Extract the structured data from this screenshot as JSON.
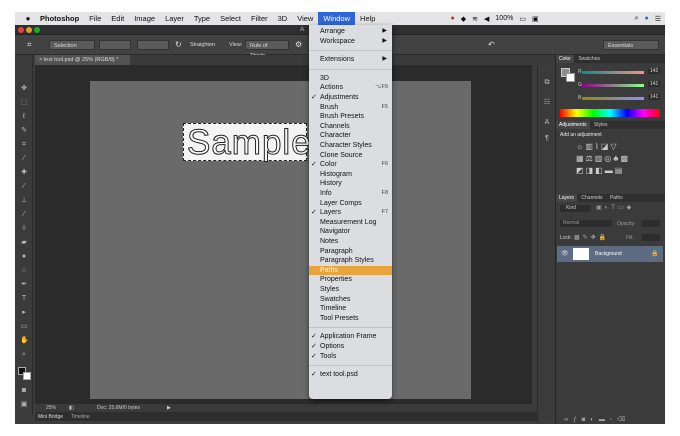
{
  "menubar": {
    "apple": "",
    "items": [
      "Photoshop",
      "File",
      "Edit",
      "Image",
      "Layer",
      "Type",
      "Select",
      "Filter",
      "3D",
      "View",
      "Window",
      "Help"
    ],
    "battery": "100%"
  },
  "options": {
    "preset": "Selection",
    "straighten": "Straighten",
    "view_label": "View:",
    "view_value": "Rule of Thirds",
    "workspace": "Essentials"
  },
  "title_fragment": "A",
  "document_tab": "text tool.psd @ 25% (RGB/8) *",
  "canvas_text": "Sample",
  "status": {
    "zoom": "25%",
    "doc": "Doc: 25.6M/0 bytes"
  },
  "bottom_tabs": [
    "Mini Bridge",
    "Timeline"
  ],
  "color_panel": {
    "tabs": [
      "Color",
      "Swatches"
    ],
    "sliders": [
      {
        "label": "R",
        "value": "142",
        "color": "#e24a4a"
      },
      {
        "label": "G",
        "value": "141",
        "color": "#4ac84a"
      },
      {
        "label": "B",
        "value": "141",
        "color": "#4a6ae2"
      }
    ]
  },
  "adjustments_panel": {
    "tabs": [
      "Adjustments",
      "Styles"
    ],
    "heading": "Add an adjustment"
  },
  "layers_panel": {
    "tabs": [
      "Layers",
      "Channels",
      "Paths"
    ],
    "kind": "Kind",
    "blend": "Normal",
    "opacity_label": "Opacity:",
    "lock_label": "Lock:",
    "fill_label": "Fill:",
    "layer_name": "Background"
  },
  "window_menu": [
    {
      "label": "Arrange",
      "arrow": "▶"
    },
    {
      "label": "Workspace",
      "arrow": "▶"
    },
    {
      "sep": true
    },
    {
      "label": "Extensions",
      "arrow": "▶"
    },
    {
      "sep": true
    },
    {
      "label": "3D"
    },
    {
      "label": "Actions",
      "shortcut": "⌥F9"
    },
    {
      "label": "Adjustments",
      "checked": true
    },
    {
      "label": "Brush",
      "shortcut": "F5"
    },
    {
      "label": "Brush Presets"
    },
    {
      "label": "Channels"
    },
    {
      "label": "Character"
    },
    {
      "label": "Character Styles"
    },
    {
      "label": "Clone Source"
    },
    {
      "label": "Color",
      "checked": true,
      "shortcut": "F6"
    },
    {
      "label": "Histogram"
    },
    {
      "label": "History"
    },
    {
      "label": "Info",
      "shortcut": "F8"
    },
    {
      "label": "Layer Comps"
    },
    {
      "label": "Layers",
      "checked": true,
      "shortcut": "F7"
    },
    {
      "label": "Measurement Log"
    },
    {
      "label": "Navigator"
    },
    {
      "label": "Notes"
    },
    {
      "label": "Paragraph"
    },
    {
      "label": "Paragraph Styles"
    },
    {
      "label": "Paths",
      "highlighted": true
    },
    {
      "label": "Properties"
    },
    {
      "label": "Styles"
    },
    {
      "label": "Swatches"
    },
    {
      "label": "Timeline"
    },
    {
      "label": "Tool Presets"
    },
    {
      "sep": true
    },
    {
      "label": "Application Frame",
      "checked": true
    },
    {
      "label": "Options",
      "checked": true
    },
    {
      "label": "Tools",
      "checked": true
    },
    {
      "sep": true
    },
    {
      "label": "text tool.psd",
      "checked": true
    }
  ],
  "colors": {
    "menu_highlight": "#e8a33b",
    "menubar_active": "#2f66d6"
  }
}
